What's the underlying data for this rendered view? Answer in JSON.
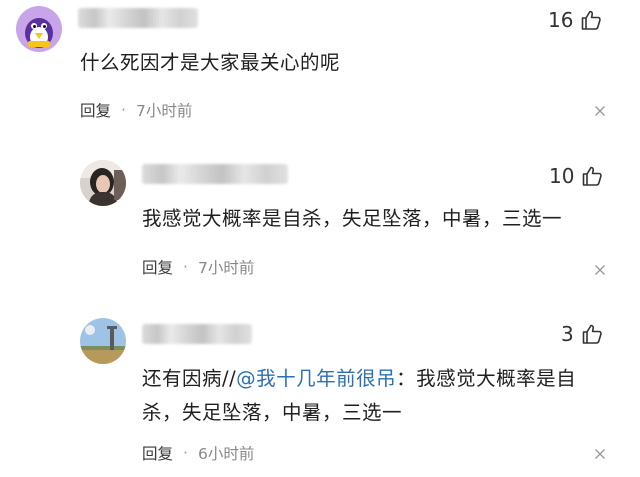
{
  "comments": [
    {
      "likes": "16",
      "text": "什么死因才是大家最关心的呢",
      "reply_label": "回复",
      "time": "7小时前"
    },
    {
      "likes": "10",
      "text": "我感觉大概率是自杀，失足坠落，中暑，三选一",
      "reply_label": "回复",
      "time": "7小时前"
    },
    {
      "likes": "3",
      "text_before": "还有因病//",
      "mention": "@我十几年前很吊",
      "text_line1_after": "：我感觉大概率是自",
      "text_line2": "杀，失足坠落，中暑，三选一",
      "reply_label": "回复",
      "time": "6小时前"
    }
  ],
  "meta_separator": "·",
  "icons": {
    "like": "thumbs-up-icon",
    "close": "close-icon"
  }
}
